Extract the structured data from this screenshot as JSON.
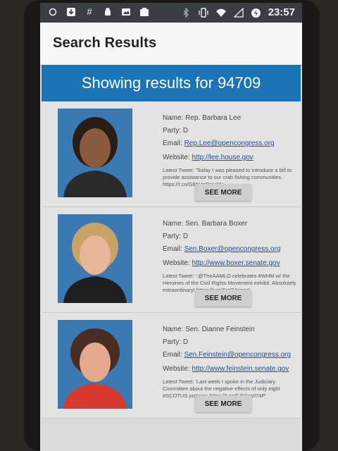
{
  "status_bar": {
    "time": "23:57",
    "left_icons": [
      "circle-icon",
      "download-icon",
      "hash-icon",
      "android-icon",
      "image-icon",
      "gallery-icon"
    ],
    "right_icons": [
      "bluetooth-icon",
      "vibrate-icon",
      "wifi-icon",
      "signal-icon",
      "data-saver-icon"
    ]
  },
  "app_bar": {
    "title": "Search Results"
  },
  "banner": {
    "text": "Showing results for 94709"
  },
  "results": [
    {
      "name": "Name: Rep. Barbara Lee",
      "party": "Party: D",
      "email_label": "Email:",
      "email": "Rep.Lee@opencongress.org",
      "website_label": "Website:",
      "website": "http://lee.house.gov",
      "tweet": "Latest Tweet: 'Today I was pleased to introduce a bill to provide assistance to our crab fishing communities. https://t.co/G6hHoRwu2A'",
      "button": "SEE MORE",
      "suit": "#2a2a2a",
      "hair": "#2a1d16",
      "skin": "#8a5a3e"
    },
    {
      "name": "Name: Sen. Barbara Boxer",
      "party": "Party: D",
      "email_label": "Email:",
      "email": "Sen.Boxer@opencongress.org",
      "website_label": "Website:",
      "website": "http://www.boxer.senate.gov",
      "tweet": "Latest Tweet: '.@TheAAMLO celebrates #WHM w/ the Heroines of the Civil Rights Movement exhibit. Absolutely extraordinary! https://t.co/6rgQJxjcaq'",
      "button": "SEE MORE",
      "suit": "#1e1e1e",
      "hair": "#c9a266",
      "skin": "#e8b79a"
    },
    {
      "name": "Name: Sen. Dianne Feinstein",
      "party": "Party: D",
      "email_label": "Email:",
      "email": "Sen.Feinstein@opencongress.org",
      "website_label": "Website:",
      "website": "http://www.feinstein.senate.gov",
      "tweet": "Latest Tweet: 'Last week I spoke in the Judiciary Committee about the negative effects of only eight #SCOTUS justices: https://t.co/E4kKeVi74P'",
      "button": "SEE MORE",
      "suit": "#d8392e",
      "hair": "#4a2d22",
      "skin": "#e4a98c"
    }
  ],
  "colors": {
    "banner": "#1b74b5",
    "link": "#1a4fa0",
    "status_bar": "#3a3d42"
  }
}
